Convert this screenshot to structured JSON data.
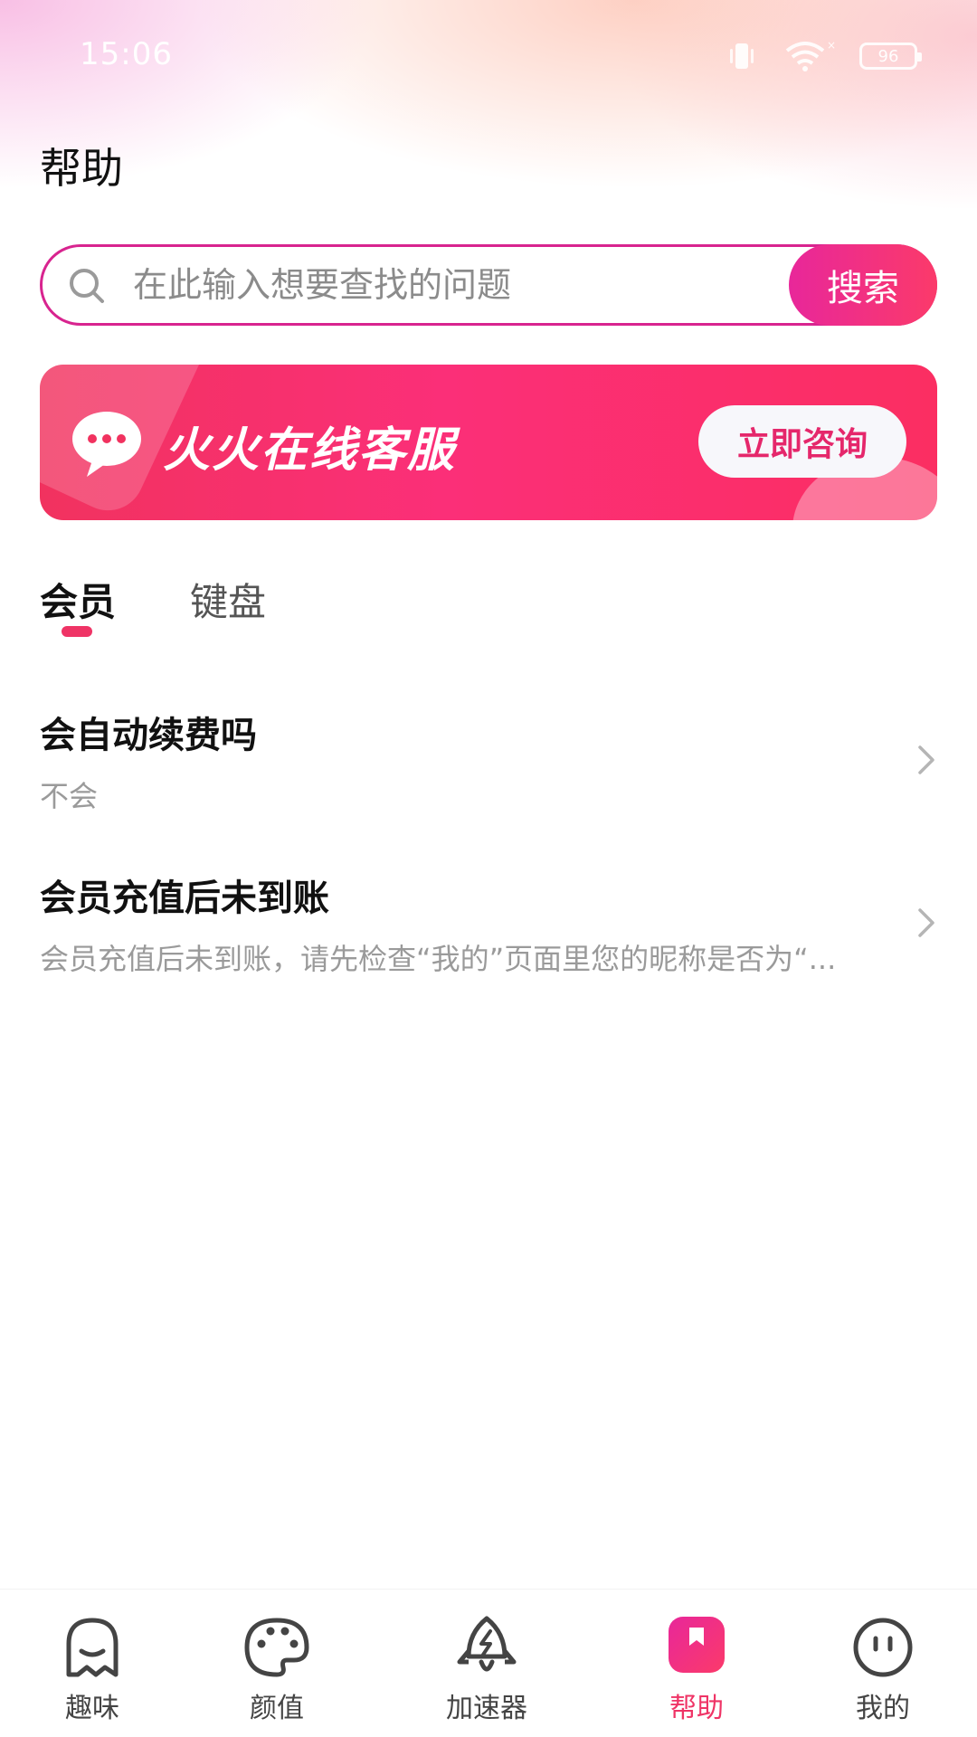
{
  "status_bar": {
    "time": "15:06",
    "battery": "96"
  },
  "page": {
    "title": "帮助"
  },
  "search": {
    "placeholder": "在此输入想要查找的问题",
    "button_label": "搜索"
  },
  "banner": {
    "title": "火火在线客服",
    "button_label": "立即咨询"
  },
  "tabs": [
    {
      "label": "会员",
      "active": true
    },
    {
      "label": "键盘",
      "active": false
    }
  ],
  "faq": [
    {
      "title": "会自动续费吗",
      "description": "不会"
    },
    {
      "title": "会员充值后未到账",
      "description": "会员充值后未到账，请先检查“我的”页面里您的昵称是否为“..."
    }
  ],
  "bottom_nav": [
    {
      "label": "趣味",
      "icon": "ghost-icon",
      "active": false
    },
    {
      "label": "颜值",
      "icon": "palette-icon",
      "active": false
    },
    {
      "label": "加速器",
      "icon": "rocket-icon",
      "active": false
    },
    {
      "label": "帮助",
      "icon": "bookmark-icon",
      "active": true
    },
    {
      "label": "我的",
      "icon": "face-icon",
      "active": false
    }
  ],
  "colors": {
    "accent": "#ef3466",
    "search_border": "#d8248f",
    "banner": "#f7306a"
  }
}
